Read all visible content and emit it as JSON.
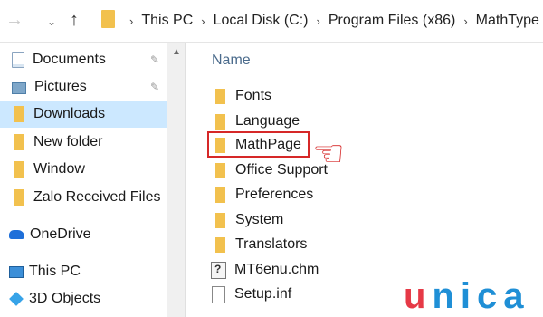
{
  "address_bar": {
    "back_glyph": "→",
    "recent_glyph": "⌄",
    "up_glyph": "↑",
    "breadcrumbs": [
      "This PC",
      "Local Disk (C:)",
      "Program Files (x86)",
      "MathType"
    ],
    "separator": "›"
  },
  "navigation_pane": {
    "items": [
      {
        "label": "Documents",
        "icon": "documents-icon",
        "pinned": true
      },
      {
        "label": "Pictures",
        "icon": "pictures-icon",
        "pinned": true
      },
      {
        "label": "Downloads",
        "icon": "folder-icon",
        "selected": true
      },
      {
        "label": "New folder",
        "icon": "folder-icon"
      },
      {
        "label": "Window",
        "icon": "folder-icon"
      },
      {
        "label": "Zalo Received Files",
        "icon": "folder-icon"
      },
      {
        "label": "OneDrive",
        "icon": "onedrive-icon"
      },
      {
        "label": "This PC",
        "icon": "this-pc-icon"
      },
      {
        "label": "3D Objects",
        "icon": "3d-objects-icon"
      }
    ],
    "pin_glyph": "✎",
    "scroll_up_glyph": "▲"
  },
  "file_list": {
    "column_header": "Name",
    "items": [
      {
        "name": "Fonts",
        "type": "folder"
      },
      {
        "name": "Language",
        "type": "folder"
      },
      {
        "name": "MathPage",
        "type": "folder",
        "highlighted": true
      },
      {
        "name": "Office Support",
        "type": "folder"
      },
      {
        "name": "Preferences",
        "type": "folder"
      },
      {
        "name": "System",
        "type": "folder"
      },
      {
        "name": "Translators",
        "type": "folder"
      },
      {
        "name": "MT6enu.chm",
        "type": "help-file"
      },
      {
        "name": "Setup.inf",
        "type": "setup-info-file"
      }
    ]
  },
  "annotation": {
    "pointer_glyph": "☜",
    "color": "#d62828"
  },
  "watermark": {
    "letters": [
      "u",
      "n",
      "i",
      "c",
      "a"
    ],
    "colors": {
      "u": "#e63946",
      "rest": "#1f8fd6"
    }
  }
}
